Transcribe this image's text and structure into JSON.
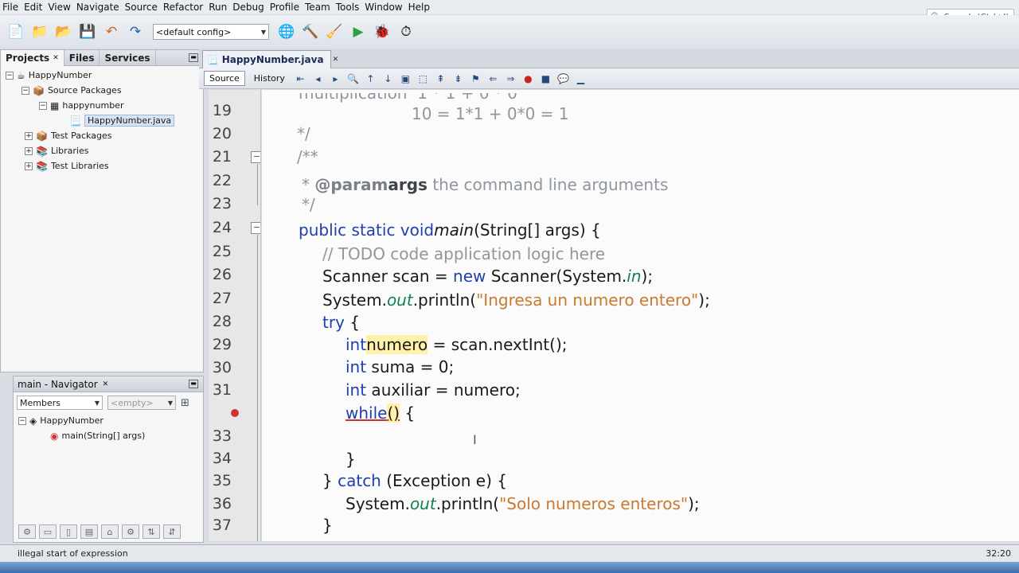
{
  "menu": [
    "File",
    "Edit",
    "View",
    "Navigate",
    "Source",
    "Refactor",
    "Run",
    "Debug",
    "Profile",
    "Team",
    "Tools",
    "Window",
    "Help"
  ],
  "search": {
    "placeholder": "Search (Ctrl+I)"
  },
  "toolbar": {
    "config": "<default config>"
  },
  "projects": {
    "tabs": [
      "Projects",
      "Files",
      "Services"
    ],
    "tree": [
      {
        "label": "HappyNumber",
        "level": 0,
        "icon": "project-icon"
      },
      {
        "label": "Source Packages",
        "level": 1,
        "icon": "package-folder-icon"
      },
      {
        "label": "happynumber",
        "level": 2,
        "icon": "package-icon"
      },
      {
        "label": "HappyNumber.java",
        "level": 3,
        "icon": "java-file-icon",
        "selected": true
      },
      {
        "label": "Test Packages",
        "level": 1,
        "icon": "package-folder-icon"
      },
      {
        "label": "Libraries",
        "level": 1,
        "icon": "library-icon"
      },
      {
        "label": "Test Libraries",
        "level": 1,
        "icon": "library-icon"
      }
    ]
  },
  "navigator": {
    "title": "main - Navigator",
    "members_select": "Members",
    "filter_select": "<empty>",
    "tree": [
      {
        "label": "HappyNumber",
        "level": 0
      },
      {
        "label": "main(String[] args)",
        "level": 1
      }
    ]
  },
  "editor": {
    "tab": "HappyNumber.java",
    "source_button": "Source",
    "history_button": "History",
    "line_numbers": [
      "19",
      "20",
      "21",
      "22",
      "23",
      "24",
      "25",
      "26",
      "27",
      "28",
      "29",
      "30",
      "31",
      "",
      "33",
      "34",
      "35",
      "36",
      "37"
    ]
  },
  "status": {
    "message": "illegal start of expression",
    "position": "32:20"
  }
}
